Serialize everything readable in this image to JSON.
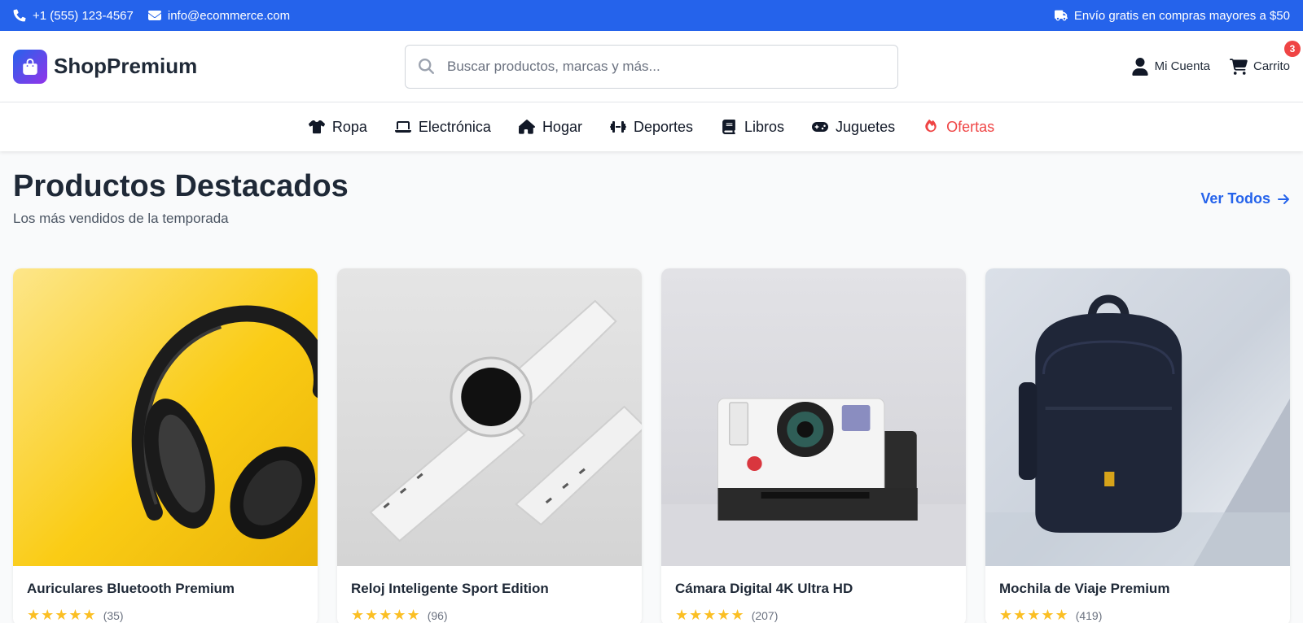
{
  "topbar": {
    "phone": "+1 (555) 123-4567",
    "email": "info@ecommerce.com",
    "shipping": "Envío gratis en compras mayores a $50",
    "color": "#2563eb"
  },
  "header": {
    "brand": "ShopPremium",
    "search_placeholder": "Buscar productos, marcas y más...",
    "account_label": "Mi Cuenta",
    "cart_label": "Carrito",
    "cart_count": "3"
  },
  "nav": {
    "items": [
      {
        "label": "Ropa",
        "icon": "tshirt-icon"
      },
      {
        "label": "Electrónica",
        "icon": "laptop-icon"
      },
      {
        "label": "Hogar",
        "icon": "home-icon"
      },
      {
        "label": "Deportes",
        "icon": "dumbbell-icon"
      },
      {
        "label": "Libros",
        "icon": "book-icon"
      },
      {
        "label": "Juguetes",
        "icon": "gamepad-icon"
      },
      {
        "label": "Ofertas",
        "icon": "fire-icon",
        "color": "#ef4444"
      }
    ]
  },
  "section": {
    "title": "Productos Destacados",
    "subtitle": "Los más vendidos de la temporada",
    "view_all": "Ver Todos"
  },
  "products": [
    {
      "name": "Auriculares Bluetooth Premium",
      "stars": "★★★★★",
      "reviews": "(35)"
    },
    {
      "name": "Reloj Inteligente Sport Edition",
      "stars": "★★★★★",
      "reviews": "(96)"
    },
    {
      "name": "Cámara Digital 4K Ultra HD",
      "stars": "★★★★★",
      "reviews": "(207)"
    },
    {
      "name": "Mochila de Viaje Premium",
      "stars": "★★★★★",
      "reviews": "(419)"
    }
  ]
}
